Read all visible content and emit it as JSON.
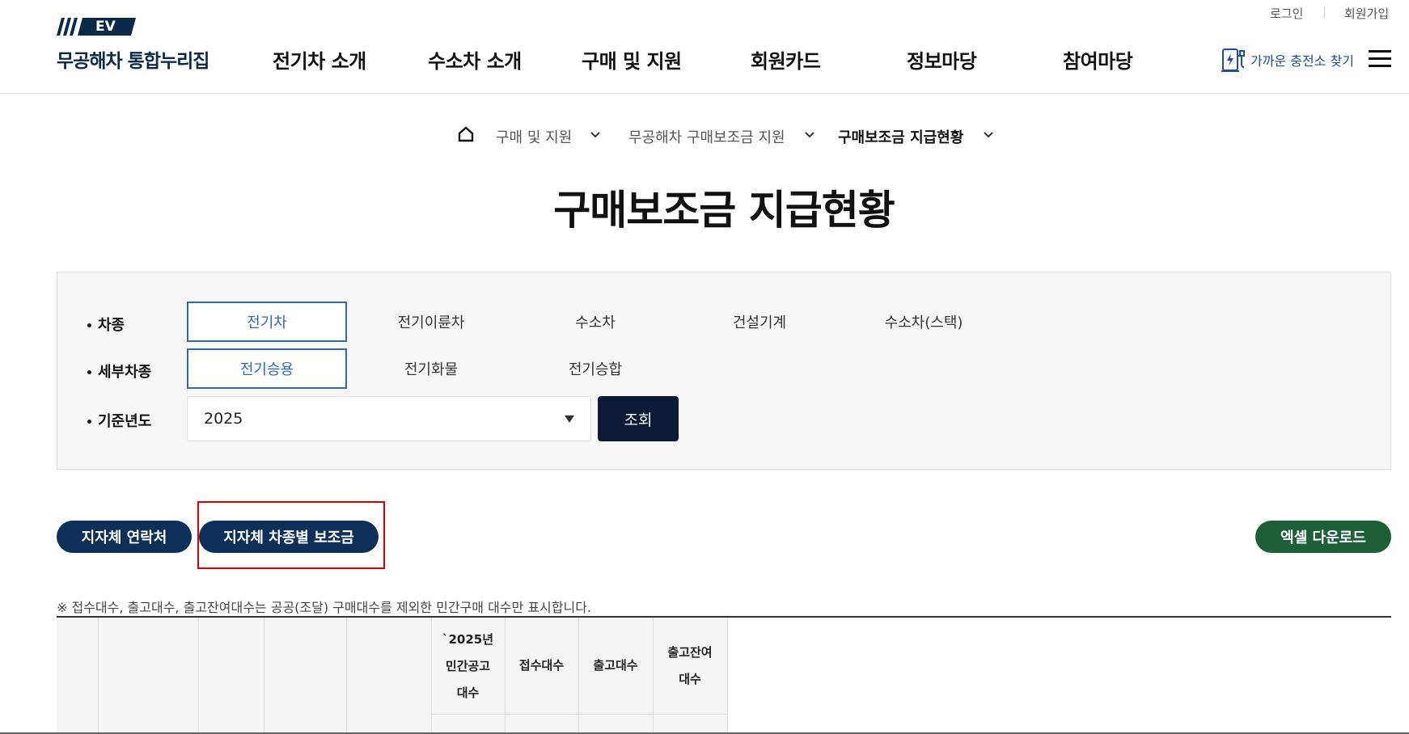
{
  "utility": {
    "login": "로그인",
    "signup": "회원가입"
  },
  "logo": {
    "badge": "EV",
    "text": "무공해차 통합누리집"
  },
  "gnb": [
    "전기차 소개",
    "수소차 소개",
    "구매 및 지원",
    "회원카드",
    "정보마당",
    "참여마당"
  ],
  "charge_link": "가까운 충전소 찾기",
  "breadcrumb": {
    "level1": "구매 및 지원",
    "level2": "무공해차 구매보조금 지원",
    "current": "구매보조금 지급현황"
  },
  "page_title": "구매보조금 지급현황",
  "filter": {
    "vehicle_type_label": "차종",
    "vehicle_types": [
      "전기차",
      "전기이륜차",
      "수소차",
      "건설기계",
      "수소차(스택)"
    ],
    "sub_type_label": "세부차종",
    "sub_types": [
      "전기승용",
      "전기화물",
      "전기승합"
    ],
    "year_label": "기준년도",
    "year_value": "2025",
    "search_button": "조회"
  },
  "buttons": {
    "contacts": "지자체 연락처",
    "subsidy_by_type": "지자체 차종별 보조금",
    "excel": "엑셀 다운로드"
  },
  "note": "※ 접수대수, 출고대수, 출고잔여대수는 공공(조달) 구매대수를 제외한 민간구매 대수만 표시합니다.",
  "table_headers": {
    "announced": [
      "`2025년",
      "민간공고",
      "대수"
    ],
    "received": "접수대수",
    "released": "출고대수",
    "remaining": [
      "출고잔여",
      "대수"
    ]
  },
  "colors": {
    "navy": "#0e2f58",
    "green": "#1d5f36",
    "accent_blue": "#2d6ab7",
    "highlight_red": "#d40000"
  }
}
